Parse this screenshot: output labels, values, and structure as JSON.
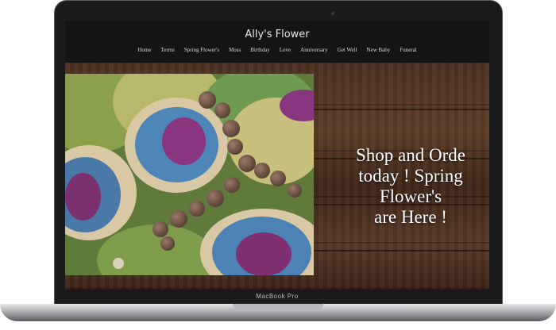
{
  "device": {
    "model_label": "MacBook Pro"
  },
  "site": {
    "title": "Ally's Flower",
    "nav": [
      "Home",
      "Terms",
      "Spring Flower's",
      "Moss",
      "Birthday",
      "Love",
      "Anniversary",
      "Get Well",
      "New Baby",
      "Funeral"
    ]
  },
  "hero": {
    "lines": [
      "Shop and Orde",
      "today ! Spring",
      "Flower's",
      "are Here !"
    ]
  },
  "colors": {
    "header_bg": "#141414",
    "laptop_body": "#1b1b1d",
    "text": "#ffffff"
  }
}
